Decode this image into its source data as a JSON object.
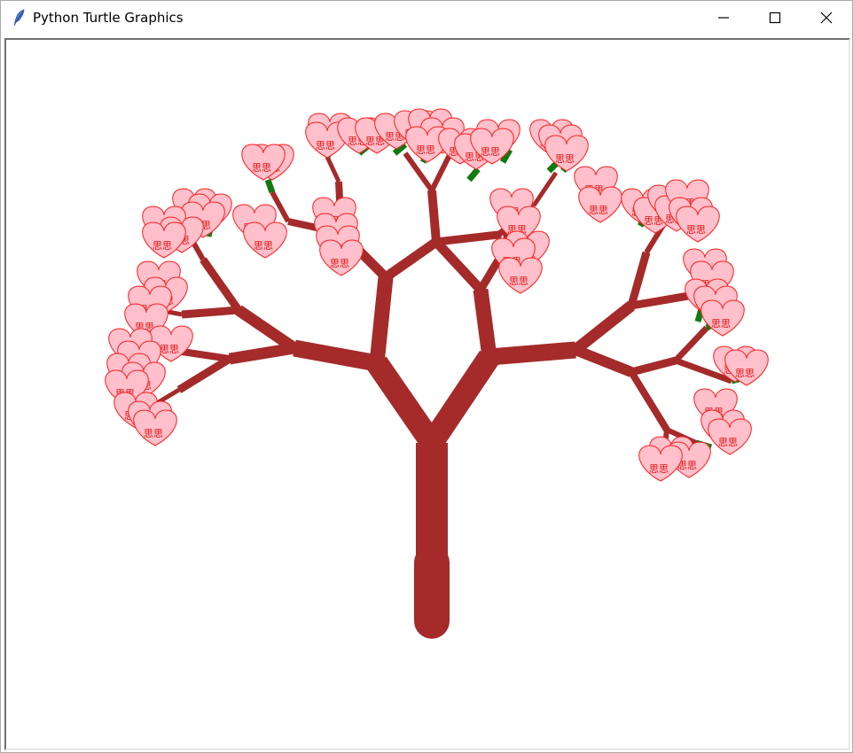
{
  "window": {
    "title": "Python Turtle Graphics",
    "icon": "feather-icon",
    "controls": [
      "minimize-icon",
      "maximize-icon",
      "close-icon"
    ]
  },
  "canvas": {
    "background": "#ffffff",
    "trunk_color": "#a52a2a",
    "twig_color": "#0f7a0f",
    "blossom_fill": "#ffc0cb",
    "blossom_stroke": "#ff2020",
    "blossom_text": "思思"
  }
}
